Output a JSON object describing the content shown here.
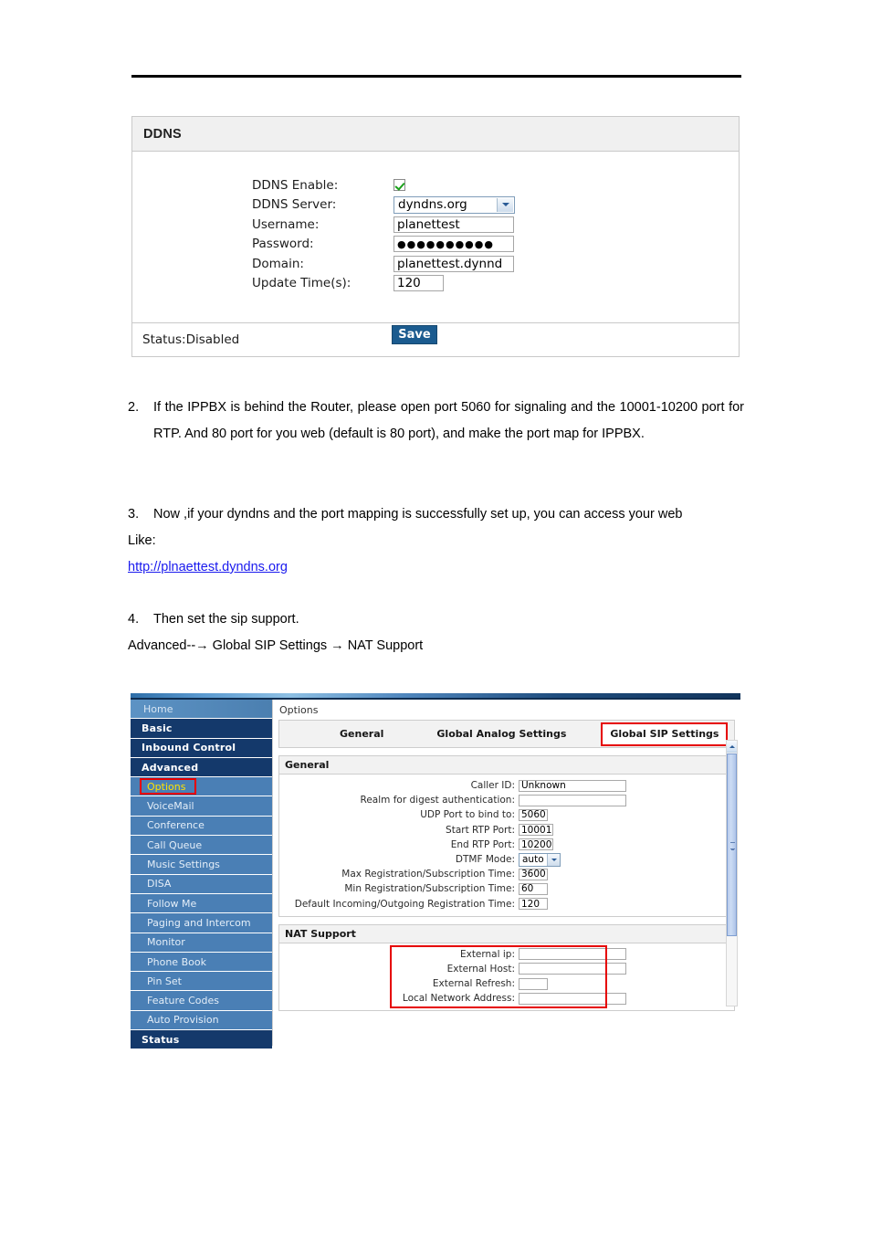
{
  "ddns_panel": {
    "title": "DDNS",
    "fields": [
      {
        "label": "DDNS Enable:",
        "type": "checkbox",
        "value": "checked"
      },
      {
        "label": "DDNS Server:",
        "type": "select",
        "value": "dyndns.org"
      },
      {
        "label": "Username:",
        "type": "text",
        "value": "planettest"
      },
      {
        "label": "Password:",
        "type": "password",
        "value": "●●●●●●●●●●"
      },
      {
        "label": "Domain:",
        "type": "text",
        "value": "planettest.dynnd"
      },
      {
        "label": "Update Time(s):",
        "type": "text",
        "value": "120"
      }
    ],
    "save_label": "Save",
    "status": "Status:Disabled"
  },
  "document": {
    "item2": {
      "num": "2.",
      "text": "If the IPPBX is behind the Router, please open port 5060 for signaling and the 10001-10200 port for RTP. And 80 port for you web (default is 80 port), and make the port map for IPPBX."
    },
    "item3": {
      "num": "3.",
      "text": "Now ,if your dyndns and the port mapping is successfully set up, you can access your web",
      "line2": "Like:",
      "link": "http://plnaettest.dyndns.org"
    },
    "item4": {
      "num": "4.",
      "text": "Then set the sip support.",
      "path": "Advanced--→ Global SIP Settings → NAT Support"
    }
  },
  "pbx": {
    "breadcrumb": "Options",
    "sidebar": [
      {
        "label": "Home",
        "kind": "top"
      },
      {
        "label": "Basic",
        "kind": "group"
      },
      {
        "label": "Inbound Control",
        "kind": "group"
      },
      {
        "label": "Advanced",
        "kind": "group"
      },
      {
        "label": "Options",
        "kind": "sub",
        "active": true
      },
      {
        "label": "VoiceMail",
        "kind": "sub"
      },
      {
        "label": "Conference",
        "kind": "sub"
      },
      {
        "label": "Call Queue",
        "kind": "sub"
      },
      {
        "label": "Music Settings",
        "kind": "sub"
      },
      {
        "label": "DISA",
        "kind": "sub"
      },
      {
        "label": "Follow Me",
        "kind": "sub"
      },
      {
        "label": "Paging and Intercom",
        "kind": "sub"
      },
      {
        "label": "Monitor",
        "kind": "sub"
      },
      {
        "label": "Phone Book",
        "kind": "sub"
      },
      {
        "label": "Pin Set",
        "kind": "sub"
      },
      {
        "label": "Feature Codes",
        "kind": "sub"
      },
      {
        "label": "Auto Provision",
        "kind": "sub"
      },
      {
        "label": "Status",
        "kind": "group"
      }
    ],
    "tabs": [
      {
        "label": "General",
        "active": false
      },
      {
        "label": "Global Analog Settings",
        "active": false
      },
      {
        "label": "Global SIP Settings",
        "active": true
      }
    ],
    "general_section": {
      "title": "General",
      "rows": [
        {
          "label": "Caller ID:",
          "type": "text",
          "value": "Unknown",
          "width": "w118"
        },
        {
          "label": "Realm for digest authentication:",
          "type": "text",
          "value": "",
          "width": "w118"
        },
        {
          "label": "UDP Port to bind to:",
          "type": "text",
          "value": "5060",
          "width": "w32"
        },
        {
          "label": "Start RTP Port:",
          "type": "text",
          "value": "10001",
          "width": "w38"
        },
        {
          "label": "End RTP Port:",
          "type": "text",
          "value": "10200",
          "width": "w38"
        },
        {
          "label": "DTMF Mode:",
          "type": "select",
          "value": "auto"
        },
        {
          "label": "Max Registration/Subscription Time:",
          "type": "text",
          "value": "3600",
          "width": "w32"
        },
        {
          "label": "Min Registration/Subscription Time:",
          "type": "text",
          "value": "60",
          "width": "w32"
        },
        {
          "label": "Default Incoming/Outgoing Registration Time:",
          "type": "text",
          "value": "120",
          "width": "w32"
        }
      ]
    },
    "nat_section": {
      "title": "NAT Support",
      "rows": [
        {
          "label": "External ip:",
          "type": "text",
          "value": "",
          "width": "w118"
        },
        {
          "label": "External Host:",
          "type": "text",
          "value": "",
          "width": "w118"
        },
        {
          "label": "External Refresh:",
          "type": "text",
          "value": "",
          "width": "w32"
        },
        {
          "label": "Local Network Address:",
          "type": "text",
          "value": "",
          "width": "w118"
        }
      ]
    }
  },
  "colors": {
    "highlight_red": "#e60000",
    "nav_group_bg": "#14396b",
    "nav_sub_bg": "#4a7fb5",
    "active_nav_text": "#ffe200",
    "link_blue": "#1a1aee",
    "save_button_bg": "#1b5b8f",
    "checkbox_check": "#1aa01a"
  }
}
